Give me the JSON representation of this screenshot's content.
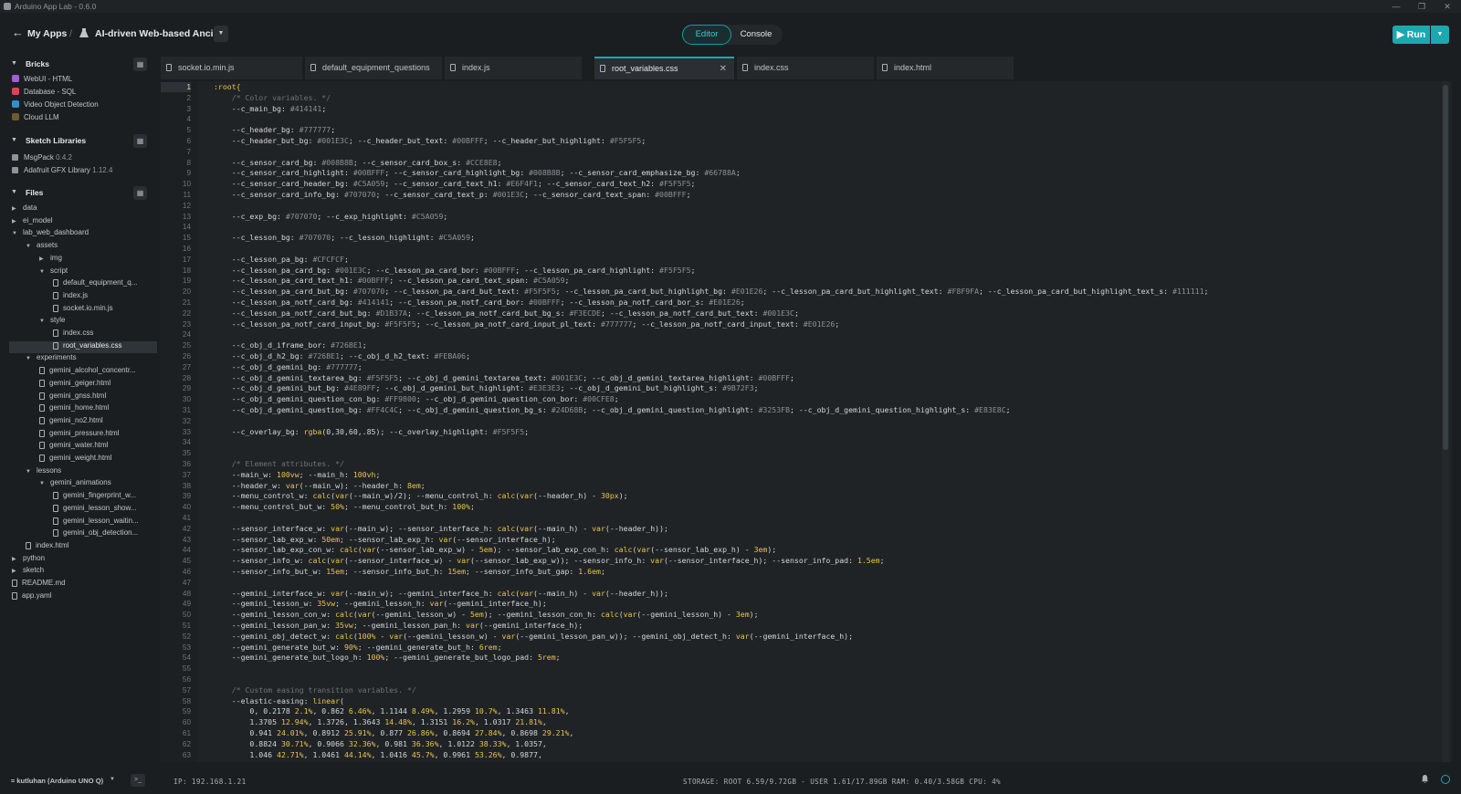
{
  "window": {
    "title": "Arduino App Lab - 0.6.0"
  },
  "header": {
    "my_apps": "My Apps",
    "separator": "/",
    "project": "AI-driven Web-based Ancil...",
    "toggle": {
      "editor": "Editor",
      "console": "Console"
    },
    "run": "Run"
  },
  "sidebar": {
    "bricks": {
      "title": "Bricks",
      "items": [
        {
          "label": "WebUI - HTML",
          "color": "#a35bd6"
        },
        {
          "label": "Database - SQL",
          "color": "#d6455b"
        },
        {
          "label": "Video Object Detection",
          "color": "#2d8fd6"
        },
        {
          "label": "Cloud LLM",
          "color": "#6f5a2a"
        }
      ]
    },
    "libraries": {
      "title": "Sketch Libraries",
      "items": [
        {
          "label": "MsgPack",
          "version": "0.4.2"
        },
        {
          "label": "Adafruit GFX Library",
          "version": "1.12.4"
        }
      ]
    },
    "files": {
      "title": "Files",
      "tree": [
        "data",
        "ei_model",
        "lab_web_dashboard",
        "assets",
        "img",
        "script",
        "default_equipment_q...",
        "index.js",
        "socket.io.min.js",
        "style",
        "index.css",
        "root_variables.css",
        "experiments",
        "gemini_alcohol_concentr...",
        "gemini_geiger.html",
        "gemini_gnss.html",
        "gemini_home.html",
        "gemini_no2.html",
        "gemini_pressure.html",
        "gemini_water.html",
        "gemini_weight.html",
        "lessons",
        "gemini_animations",
        "gemini_fingerprint_w...",
        "gemini_lesson_show...",
        "gemini_lesson_waitin...",
        "gemini_obj_detection...",
        "index.html",
        "python",
        "sketch",
        "README.md",
        "app.yaml"
      ]
    }
  },
  "tabs": [
    "socket.io.min.js",
    "default_equipment_questions",
    "index.js",
    "root_variables.css",
    "index.css",
    "index.html"
  ],
  "editor": {
    "line_numbers": [
      "1",
      "2",
      "3",
      "4",
      "5",
      "6",
      "7",
      "8",
      "9",
      "10",
      "11",
      "12",
      "13",
      "14",
      "15",
      "16",
      "17",
      "18",
      "19",
      "20",
      "21",
      "22",
      "23",
      "24",
      "25",
      "26",
      "27",
      "28",
      "29",
      "30",
      "31",
      "32",
      "33",
      "34",
      "35",
      "36",
      "37",
      "38",
      "39",
      "40",
      "41",
      "42",
      "43",
      "44",
      "45",
      "46",
      "47",
      "48",
      "49",
      "50",
      "51",
      "52",
      "53",
      "54",
      "55",
      "56",
      "57",
      "58",
      "59",
      "60",
      "61",
      "62",
      "63"
    ],
    "lines": [
      ":root{",
      "    /* Color variables. */",
      "    --c_main_bg: #414141;",
      "",
      "    --c_header_bg: #777777;",
      "    --c_header_but_bg: #001E3C; --c_header_but_text: #00BFFF; --c_header_but_highlight: #F5F5F5;",
      "",
      "    --c_sensor_card_bg: #008B8B; --c_sensor_card_box_s: #CCE8E8;",
      "    --c_sensor_card_highlight: #00BFFF; --c_sensor_card_highlight_bg: #008B8B; --c_sensor_card_emphasize_bg: #66788A;",
      "    --c_sensor_card_header_bg: #C5A059; --c_sensor_card_text_h1: #E6F4F1; --c_sensor_card_text_h2: #F5F5F5;",
      "    --c_sensor_card_info_bg: #707070; --c_sensor_card_text_p: #001E3C; --c_sensor_card_text_span: #00BFFF;",
      "",
      "    --c_exp_bg: #707070; --c_exp_highlight: #C5A059;",
      "",
      "    --c_lesson_bg: #707070; --c_lesson_highlight: #C5A059;",
      "",
      "    --c_lesson_pa_bg: #CFCFCF;",
      "    --c_lesson_pa_card_bg: #001E3C; --c_lesson_pa_card_bor: #00BFFF; --c_lesson_pa_card_highlight: #F5F5F5;",
      "    --c_lesson_pa_card_text_h1: #00BFFF; --c_lesson_pa_card_text_span: #C5A059;",
      "    --c_lesson_pa_card_but_bg: #707070; --c_lesson_pa_card_but_text: #F5F5F5; --c_lesson_pa_card_but_highlight_bg: #E01E26; --c_lesson_pa_card_but_highlight_text: #F8F9FA; --c_lesson_pa_card_but_highlight_text_s: #111111;",
      "    --c_lesson_pa_notf_card_bg: #414141; --c_lesson_pa_notf_card_bor: #00BFFF; --c_lesson_pa_notf_card_bor_s: #E01E26;",
      "    --c_lesson_pa_notf_card_but_bg: #D1B37A; --c_lesson_pa_notf_card_but_bg_s: #F3ECDE; --c_lesson_pa_notf_card_but_text: #001E3C;",
      "    --c_lesson_pa_notf_card_input_bg: #F5F5F5; --c_lesson_pa_notf_card_input_pl_text: #777777; --c_lesson_pa_notf_card_input_text: #E01E26;",
      "",
      "    --c_obj_d_iframe_bor: #726BE1;",
      "    --c_obj_d_h2_bg: #726BE1; --c_obj_d_h2_text: #FEBA06;",
      "    --c_obj_d_gemini_bg: #777777;",
      "    --c_obj_d_gemini_textarea_bg: #F5F5F5; --c_obj_d_gemini_textarea_text: #001E3C; --c_obj_d_gemini_textarea_highlight: #00BFFF;",
      "    --c_obj_d_gemini_but_bg: #4E89FF; --c_obj_d_gemini_but_highlight: #E3E3E3; --c_obj_d_gemini_but_highlight_s: #9B72F3;",
      "    --c_obj_d_gemini_question_con_bg: #FF9800; --c_obj_d_gemini_question_con_bor: #00CFE8;",
      "    --c_obj_d_gemini_question_bg: #FF4C4C; --c_obj_d_gemini_question_bg_s: #24D68B; --c_obj_d_gemini_question_highlight: #3253FB; --c_obj_d_gemini_question_highlight_s: #E83E8C;",
      "",
      "    --c_overlay_bg: rgba(0,30,60,.85); --c_overlay_highlight: #F5F5F5;",
      "",
      "",
      "    /* Element attributes. */",
      "    --main_w: 100vw; --main_h: 100vh;",
      "    --header_w: var(--main_w); --header_h: 8em;",
      "    --menu_control_w: calc(var(--main_w)/2); --menu_control_h: calc(var(--header_h) - 30px);",
      "    --menu_control_but_w: 50%; --menu_control_but_h: 100%;",
      "",
      "    --sensor_interface_w: var(--main_w); --sensor_interface_h: calc(var(--main_h) - var(--header_h));",
      "    --sensor_lab_exp_w: 50em; --sensor_lab_exp_h: var(--sensor_interface_h);",
      "    --sensor_lab_exp_con_w: calc(var(--sensor_lab_exp_w) - 5em); --sensor_lab_exp_con_h: calc(var(--sensor_lab_exp_h) - 3em);",
      "    --sensor_info_w: calc(var(--sensor_interface_w) - var(--sensor_lab_exp_w)); --sensor_info_h: var(--sensor_interface_h); --sensor_info_pad: 1.5em;",
      "    --sensor_info_but_w: 15em; --sensor_info_but_h: 15em; --sensor_info_but_gap: 1.6em;",
      "",
      "    --gemini_interface_w: var(--main_w); --gemini_interface_h: calc(var(--main_h) - var(--header_h));",
      "    --gemini_lesson_w: 35vw; --gemini_lesson_h: var(--gemini_interface_h);",
      "    --gemini_lesson_con_w: calc(var(--gemini_lesson_w) - 5em); --gemini_lesson_con_h: calc(var(--gemini_lesson_h) - 3em);",
      "    --gemini_lesson_pan_w: 35vw; --gemini_lesson_pan_h: var(--gemini_interface_h);",
      "    --gemini_obj_detect_w: calc(100% - var(--gemini_lesson_w) - var(--gemini_lesson_pan_w)); --gemini_obj_detect_h: var(--gemini_interface_h);",
      "    --gemini_generate_but_w: 90%; --gemini_generate_but_h: 6rem;",
      "    --gemini_generate_but_logo_h: 100%; --gemini_generate_but_logo_pad: 5rem;",
      "",
      "",
      "    /* Custom easing transition variables. */",
      "    --elastic-easing: linear(",
      "        0, 0.2178 2.1%, 0.862 6.46%, 1.1144 8.49%, 1.2959 10.7%, 1.3463 11.81%,",
      "        1.3705 12.94%, 1.3726, 1.3643 14.48%, 1.3151 16.2%, 1.0317 21.81%,",
      "        0.941 24.01%, 0.8912 25.91%, 0.877 26.86%, 0.8694 27.84%, 0.8698 29.21%,",
      "        0.8824 30.71%, 0.9066 32.36%, 0.981 36.36%, 1.0122 38.33%, 1.0357,",
      "        1.046 42.71%, 1.0461 44.14%, 1.0416 45.7%, 0.9961 53.26%, 0.9877,"
    ]
  },
  "status": {
    "device": "kutluhan (Arduino UNO Q)",
    "ip": "IP: 192.168.1.21",
    "stats": "STORAGE: ROOT 6.59/9.72GB - USER 1.61/17.89GB  RAM: 0.40/3.58GB  CPU: 4%"
  },
  "colors": {
    "accent": "#1ba8b0",
    "editor_bg": "#202326",
    "sidebar_bg": "#1b1e21"
  }
}
